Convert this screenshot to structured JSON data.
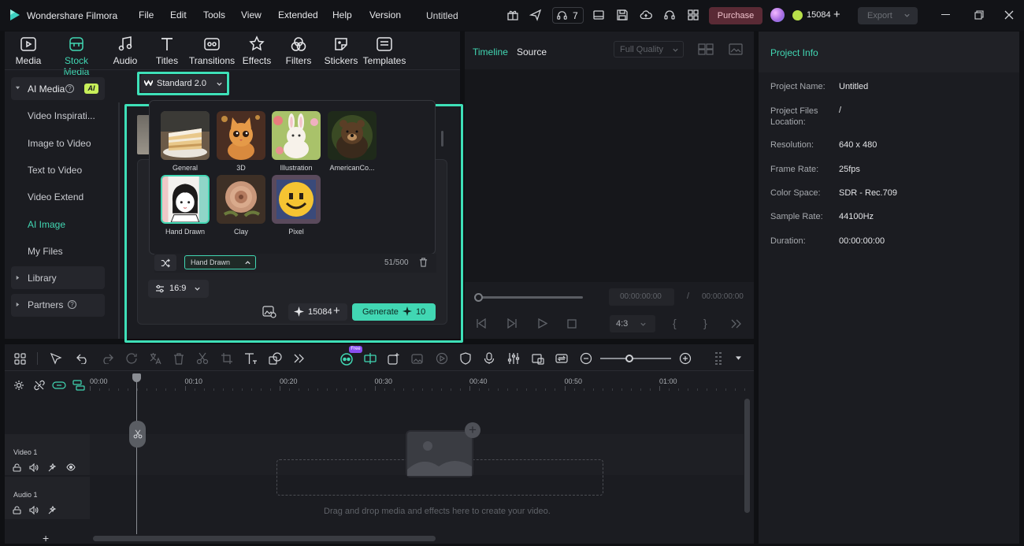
{
  "app": {
    "name": "Wondershare Filmora",
    "menu": [
      "File",
      "Edit",
      "Tools",
      "View",
      "Extended",
      "Help",
      "Version"
    ],
    "project_title": "Untitled",
    "notif_count": "7",
    "purchase_label": "Purchase",
    "credits": "15084",
    "export_label": "Export"
  },
  "toolbar_tabs": [
    {
      "label": "Media",
      "icon": "media-icon"
    },
    {
      "label": "Stock Media",
      "icon": "stock-media-icon"
    },
    {
      "label": "Audio",
      "icon": "audio-icon"
    },
    {
      "label": "Titles",
      "icon": "titles-icon"
    },
    {
      "label": "Transitions",
      "icon": "transitions-icon"
    },
    {
      "label": "Effects",
      "icon": "effects-icon"
    },
    {
      "label": "Filters",
      "icon": "filters-icon"
    },
    {
      "label": "Stickers",
      "icon": "stickers-icon"
    },
    {
      "label": "Templates",
      "icon": "templates-icon"
    }
  ],
  "sidebar": {
    "ai_media_label": "AI Media",
    "ai_badge": "AI",
    "items": [
      "Video Inspirati...",
      "Image to Video",
      "Text to Video",
      "Video Extend",
      "AI Image",
      "My Files"
    ],
    "active_index": 4,
    "library_label": "Library",
    "partners_label": "Partners"
  },
  "model_select": {
    "label": "Standard 2.0"
  },
  "styles": [
    {
      "label": "General"
    },
    {
      "label": "3D"
    },
    {
      "label": "Illustration"
    },
    {
      "label": "AmericanCo..."
    },
    {
      "label": "Hand Drawn"
    },
    {
      "label": "Clay"
    },
    {
      "label": "Pixel"
    }
  ],
  "prompt": {
    "style_chip": "Hand Drawn",
    "char_count": "51/500"
  },
  "aspect": {
    "label": "16:9"
  },
  "generate": {
    "credits": "15084",
    "label": "Generate",
    "cost": "10"
  },
  "preview": {
    "tab_timeline": "Timeline",
    "tab_source": "Source",
    "quality": "Full Quality",
    "time_current": "00:00:00:00",
    "time_sep": "/",
    "time_total": "00:00:00:00",
    "ratio": "4:3"
  },
  "project_info": {
    "title": "Project Info",
    "rows": [
      {
        "label": "Project Name:",
        "value": "Untitled"
      },
      {
        "label": "Project Files Location:",
        "value": "/"
      },
      {
        "label": "Resolution:",
        "value": "640 x 480"
      },
      {
        "label": "Frame Rate:",
        "value": "25fps"
      },
      {
        "label": "Color Space:",
        "value": "SDR - Rec.709"
      },
      {
        "label": "Sample Rate:",
        "value": "44100Hz"
      },
      {
        "label": "Duration:",
        "value": "00:00:00:00"
      }
    ]
  },
  "timeline": {
    "free_badge": "Free",
    "ticks": [
      "00:00",
      "00:10",
      "00:20",
      "00:30",
      "00:40",
      "00:50",
      "01:00"
    ],
    "video_track": "Video 1",
    "audio_track": "Audio 1",
    "drop_hint": "Drag and drop media and effects here to create your video."
  },
  "colors": {
    "accent": "#41d7b3",
    "highlight": "#3ee0b8",
    "purchase": "#5a2a35"
  }
}
